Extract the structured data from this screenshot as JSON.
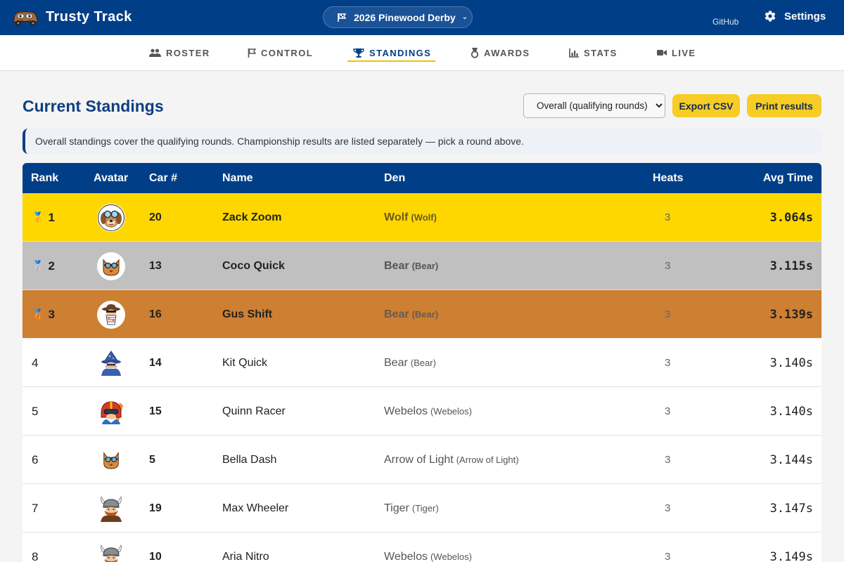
{
  "app": {
    "title": "Trusty Track"
  },
  "header": {
    "event_label": "2026 Pinewood Derby",
    "github_label": "GitHub",
    "settings_label": "Settings"
  },
  "nav": {
    "tabs": [
      {
        "label": "ROSTER",
        "icon": "users-icon"
      },
      {
        "label": "CONTROL",
        "icon": "flag-icon"
      },
      {
        "label": "STANDINGS",
        "icon": "trophy-icon",
        "active": true
      },
      {
        "label": "AWARDS",
        "icon": "medal-icon"
      },
      {
        "label": "STATS",
        "icon": "bar-chart-icon"
      },
      {
        "label": "LIVE",
        "icon": "video-icon"
      }
    ]
  },
  "main": {
    "title": "Current Standings",
    "round_select": {
      "selected": "Overall (qualifying rounds)"
    },
    "export_label": "Export CSV",
    "print_label": "Print results",
    "notice": "Overall standings cover the qualifying rounds. Championship results are listed separately — pick a round above."
  },
  "table": {
    "headers": {
      "rank": "Rank",
      "avatar": "Avatar",
      "car": "Car #",
      "name": "Name",
      "den": "Den",
      "heats": "Heats",
      "avg": "Avg Time"
    },
    "rows": [
      {
        "rank": "1",
        "medal": "🥇",
        "car": "20",
        "name": "Zack Zoom",
        "den": "Wolf",
        "den_sub": "(Wolf)",
        "heats": "3",
        "time": "3.064s",
        "avatar": "dog-goggles"
      },
      {
        "rank": "2",
        "medal": "🥈",
        "car": "13",
        "name": "Coco Quick",
        "den": "Bear",
        "den_sub": "(Bear)",
        "heats": "3",
        "time": "3.115s",
        "avatar": "cat-goggles"
      },
      {
        "rank": "3",
        "medal": "🥉",
        "car": "16",
        "name": "Gus Shift",
        "den": "Bear",
        "den_sub": "(Bear)",
        "heats": "3",
        "time": "3.139s",
        "avatar": "bandit"
      },
      {
        "rank": "4",
        "car": "14",
        "name": "Kit Quick",
        "den": "Bear",
        "den_sub": "(Bear)",
        "heats": "3",
        "time": "3.140s",
        "avatar": "wizard"
      },
      {
        "rank": "5",
        "car": "15",
        "name": "Quinn Racer",
        "den": "Webelos",
        "den_sub": "(Webelos)",
        "heats": "3",
        "time": "3.140s",
        "avatar": "racer-helmet"
      },
      {
        "rank": "6",
        "car": "5",
        "name": "Bella Dash",
        "den": "Arrow of Light",
        "den_sub": "(Arrow of Light)",
        "heats": "3",
        "time": "3.144s",
        "avatar": "cat-goggles"
      },
      {
        "rank": "7",
        "car": "19",
        "name": "Max Wheeler",
        "den": "Tiger",
        "den_sub": "(Tiger)",
        "heats": "3",
        "time": "3.147s",
        "avatar": "viking"
      },
      {
        "rank": "8",
        "car": "10",
        "name": "Aria Nitro",
        "den": "Webelos",
        "den_sub": "(Webelos)",
        "heats": "3",
        "time": "3.149s",
        "avatar": "viking"
      }
    ]
  },
  "colors": {
    "primary": "#003f87",
    "accent": "#f7cc25",
    "gold": "#ffd700",
    "silver": "#c0c0c0",
    "bronze": "#cd7f32"
  }
}
